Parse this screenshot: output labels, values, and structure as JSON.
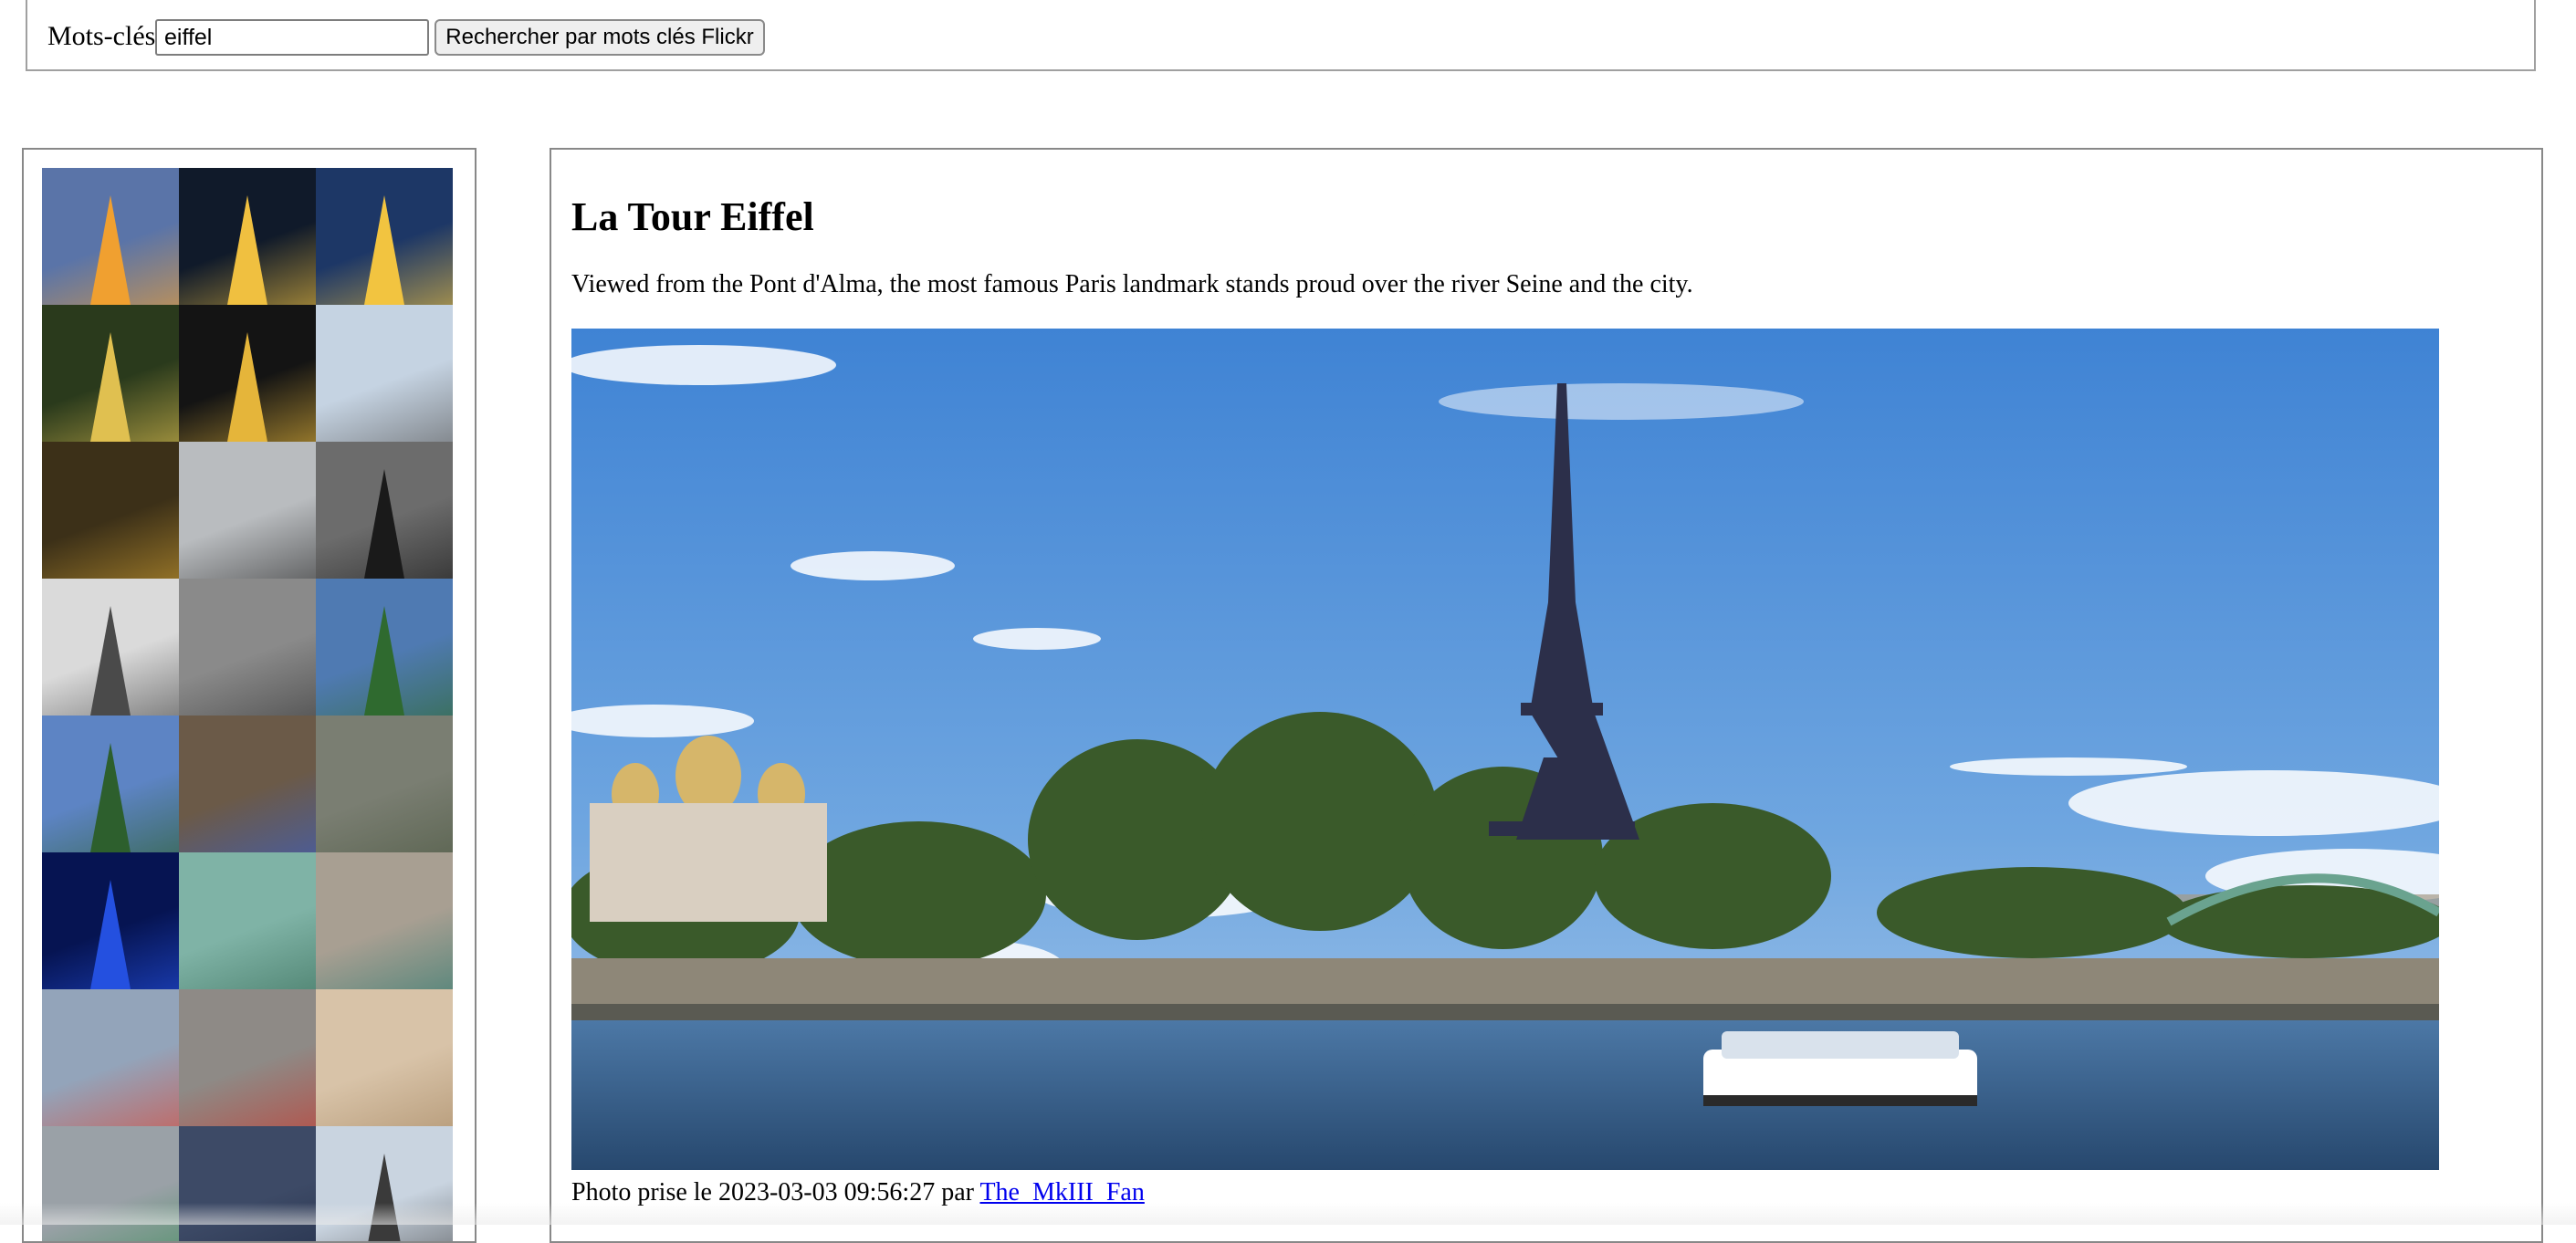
{
  "search": {
    "label": "Mots-clés",
    "value": "eiffel",
    "placeholder": "",
    "button_label": "Rechercher par mots clés Flickr"
  },
  "thumbnails": [
    {
      "name": "thumbnail-tower-sunset",
      "bg": "#5a74a8",
      "accent": "#f0a030",
      "tower": true
    },
    {
      "name": "thumbnail-tower-night-rose",
      "bg": "#101a2a",
      "accent": "#f0c040",
      "tower": true
    },
    {
      "name": "thumbnail-tower-night",
      "bg": "#1d3766",
      "accent": "#f2c440",
      "tower": true
    },
    {
      "name": "thumbnail-tower-hand",
      "bg": "#2a3a1c",
      "accent": "#e0c050",
      "tower": true
    },
    {
      "name": "thumbnail-tower-gold",
      "bg": "#141414",
      "accent": "#e5b53a",
      "tower": true
    },
    {
      "name": "thumbnail-tower-steel",
      "bg": "#c5d3e2",
      "accent": "#5a5a5a",
      "tower": false
    },
    {
      "name": "thumbnail-fire",
      "bg": "#3c3018",
      "accent": "#c89a30",
      "tower": false
    },
    {
      "name": "thumbnail-person",
      "bg": "#b9bcbf",
      "accent": "#2e2e2e",
      "tower": false
    },
    {
      "name": "thumbnail-tower-bw",
      "bg": "#6c6c6c",
      "accent": "#1a1a1a",
      "tower": true
    },
    {
      "name": "thumbnail-tower-gray",
      "bg": "#dadada",
      "accent": "#4a4a4a",
      "tower": true
    },
    {
      "name": "thumbnail-statue-bw",
      "bg": "#8a8a8a",
      "accent": "#3a3a3a",
      "tower": false
    },
    {
      "name": "thumbnail-tower-trees",
      "bg": "#4f7ab2",
      "accent": "#2f6a2f",
      "tower": true
    },
    {
      "name": "thumbnail-tower-park",
      "bg": "#5d84c4",
      "accent": "#2d5f2d",
      "tower": true
    },
    {
      "name": "thumbnail-tower-street",
      "bg": "#6b5a48",
      "accent": "#3b5ec2",
      "tower": false
    },
    {
      "name": "thumbnail-highway",
      "bg": "#7a7e72",
      "accent": "#4f5a44",
      "tower": false
    },
    {
      "name": "thumbnail-tower-blue",
      "bg": "#061452",
      "accent": "#2450e0",
      "tower": true
    },
    {
      "name": "thumbnail-bridge-green",
      "bg": "#7fb3a6",
      "accent": "#3b6f5b",
      "tower": false
    },
    {
      "name": "thumbnail-cannon",
      "bg": "#a89f92",
      "accent": "#2f7a70",
      "tower": false
    },
    {
      "name": "thumbnail-balloon-sculpture",
      "bg": "#93a4ba",
      "accent": "#d84a3a",
      "tower": false
    },
    {
      "name": "thumbnail-arc-traffic",
      "bg": "#8e8a86",
      "accent": "#c43a30",
      "tower": false
    },
    {
      "name": "thumbnail-sculpture-beige",
      "bg": "#d8c3a8",
      "accent": "#a88a66",
      "tower": false
    },
    {
      "name": "thumbnail-train",
      "bg": "#9aa1a7",
      "accent": "#2d8a4d",
      "tower": false
    },
    {
      "name": "thumbnail-car",
      "bg": "#3d4a66",
      "accent": "#1a2640",
      "tower": false
    },
    {
      "name": "thumbnail-tower-sky",
      "bg": "#c9d4e0",
      "accent": "#3a3a3a",
      "tower": true
    }
  ],
  "detail": {
    "title": "La Tour Eiffel",
    "description": "Viewed from the Pont d'Alma, the most famous Paris landmark stands proud over the river Seine and the city.",
    "caption_prefix": "Photo prise le 2023-03-03 09:56:27 par",
    "author": "The_MkIII_Fan"
  },
  "colors": {
    "link": "#0000ee",
    "sky": "#4d8ed8",
    "water": "#2f5d8c",
    "trees": "#3d5a2a"
  }
}
